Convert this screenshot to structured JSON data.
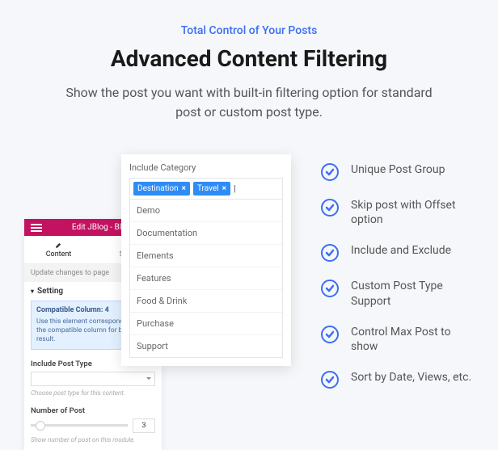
{
  "eyebrow": "Total Control of Your Posts",
  "heading": "Advanced Content Filtering",
  "subheading": "Show the post you want with built-in filtering option for standard post or custom post type.",
  "features": [
    "Unique Post Group",
    "Skip post with Offset option",
    "Include and Exclude",
    "Custom Post Type Support",
    "Control Max Post to show",
    "Sort by Date, Views, etc."
  ],
  "popup": {
    "label": "Include Category",
    "tags": [
      "Destination",
      "Travel"
    ],
    "options": [
      "Demo",
      "Documentation",
      "Elements",
      "Features",
      "Food & Drink",
      "Purchase",
      "Support"
    ]
  },
  "editor": {
    "title": "Edit JBlog - Bloc",
    "tabs": {
      "content": "Content",
      "style": "Style"
    },
    "update": "Update changes to page",
    "setting_label": "Setting",
    "compat_title": "Compatible Column: 4",
    "compat_body": "Use this element corresponding with the compatible column for better result.",
    "include_post_type": "Include Post Type",
    "include_hint": "Choose post type for this content.",
    "number_of_post": "Number of Post",
    "number_value": "3",
    "number_hint": "Show number of post on this module."
  }
}
